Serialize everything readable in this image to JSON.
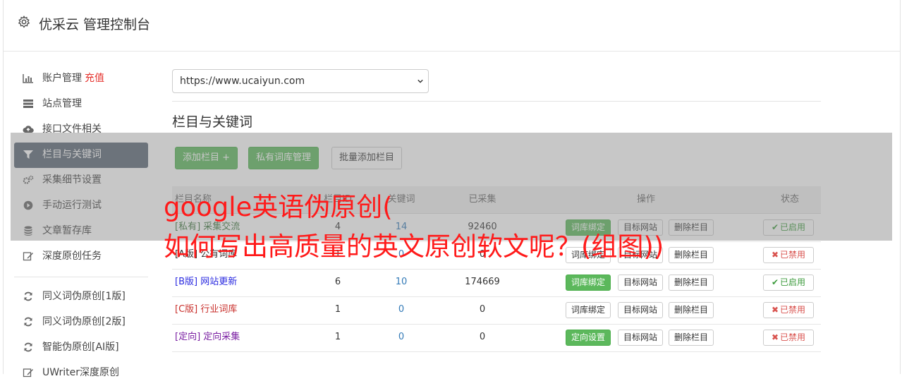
{
  "header": {
    "title": "优采云 管理控制台",
    "icon": "gear-icon"
  },
  "sidebar": {
    "items": [
      {
        "label": "账户管理",
        "icon": "bar-chart-icon",
        "badge": "充值"
      },
      {
        "label": "站点管理",
        "icon": "server-icon"
      },
      {
        "label": "接口文件相关",
        "icon": "cloud-upload-icon"
      },
      {
        "label": "栏目与关键词",
        "icon": "filter-icon",
        "active": true
      },
      {
        "label": "采集细节设置",
        "icon": "gears-icon"
      },
      {
        "label": "手动运行测试",
        "icon": "play-circle-icon"
      },
      {
        "label": "文章暂存库",
        "icon": "database-icon"
      },
      {
        "label": "深度原创任务",
        "icon": "edit-icon"
      }
    ],
    "items2": [
      {
        "label": "同义词伪原创[1版]",
        "icon": "refresh-icon"
      },
      {
        "label": "同义词伪原创[2版]",
        "icon": "refresh-icon"
      },
      {
        "label": "智能伪原创[AI版]",
        "icon": "refresh-icon"
      },
      {
        "label": "UWriter深度原创",
        "icon": "edit-icon"
      }
    ]
  },
  "site_select": {
    "value": "https://www.ucaiyun.com"
  },
  "section": {
    "title": "栏目与关键词"
  },
  "buttons": {
    "add": "添加栏目 +",
    "private_lib": "私有词库管理",
    "batch_add": "批量添加栏目"
  },
  "table": {
    "headers": {
      "name": "栏目名称",
      "id": "栏目ID",
      "count": "关键词",
      "collected": "已采集",
      "ops": "操作",
      "state": "状态"
    },
    "rows": [
      {
        "name": "[私有] 采集交流",
        "id": "4",
        "count": "14",
        "collected": "92460",
        "op1": "词库绑定",
        "op2": "目标网站",
        "op3": "删除栏目",
        "state": "已启用",
        "enabled": true,
        "name_color": "#3c763d",
        "op1_green": true
      },
      {
        "name": "[A版] 公有词库",
        "id": "1",
        "count": "0",
        "collected": "0",
        "op1": "词库绑定",
        "op2": "目标网站",
        "op3": "删除栏目",
        "state": "已禁用",
        "enabled": false,
        "name_color": "#333333",
        "op1_green": false
      },
      {
        "name": "[B版] 网站更新",
        "id": "6",
        "count": "10",
        "collected": "174669",
        "op1": "词库绑定",
        "op2": "目标网站",
        "op3": "删除栏目",
        "state": "已启用",
        "enabled": true,
        "name_color": "#2a2ae0",
        "op1_green": true
      },
      {
        "name": "[C版] 行业词库",
        "id": "1",
        "count": "0",
        "collected": "0",
        "op1": "词库绑定",
        "op2": "目标网站",
        "op3": "删除栏目",
        "state": "已禁用",
        "enabled": false,
        "name_color": "#c9302c",
        "op1_green": false
      },
      {
        "name": "[定向] 定向采集",
        "id": "1",
        "count": "0",
        "collected": "0",
        "op1": "定向设置",
        "op2": "目标网站",
        "op3": "删除栏目",
        "state": "已禁用",
        "enabled": false,
        "name_color": "#7a1fa2",
        "op1_green": true
      }
    ]
  },
  "watermark": {
    "line1": "google英语伪原创(",
    "line2": "如何写出高质量的英文原创软文呢？(组图))"
  },
  "colors": {
    "green": "#5cb85c",
    "red": "#e5322d",
    "active_bg": "#5a6676",
    "link": "#337ab7",
    "watermark": "#ff1a1a"
  }
}
